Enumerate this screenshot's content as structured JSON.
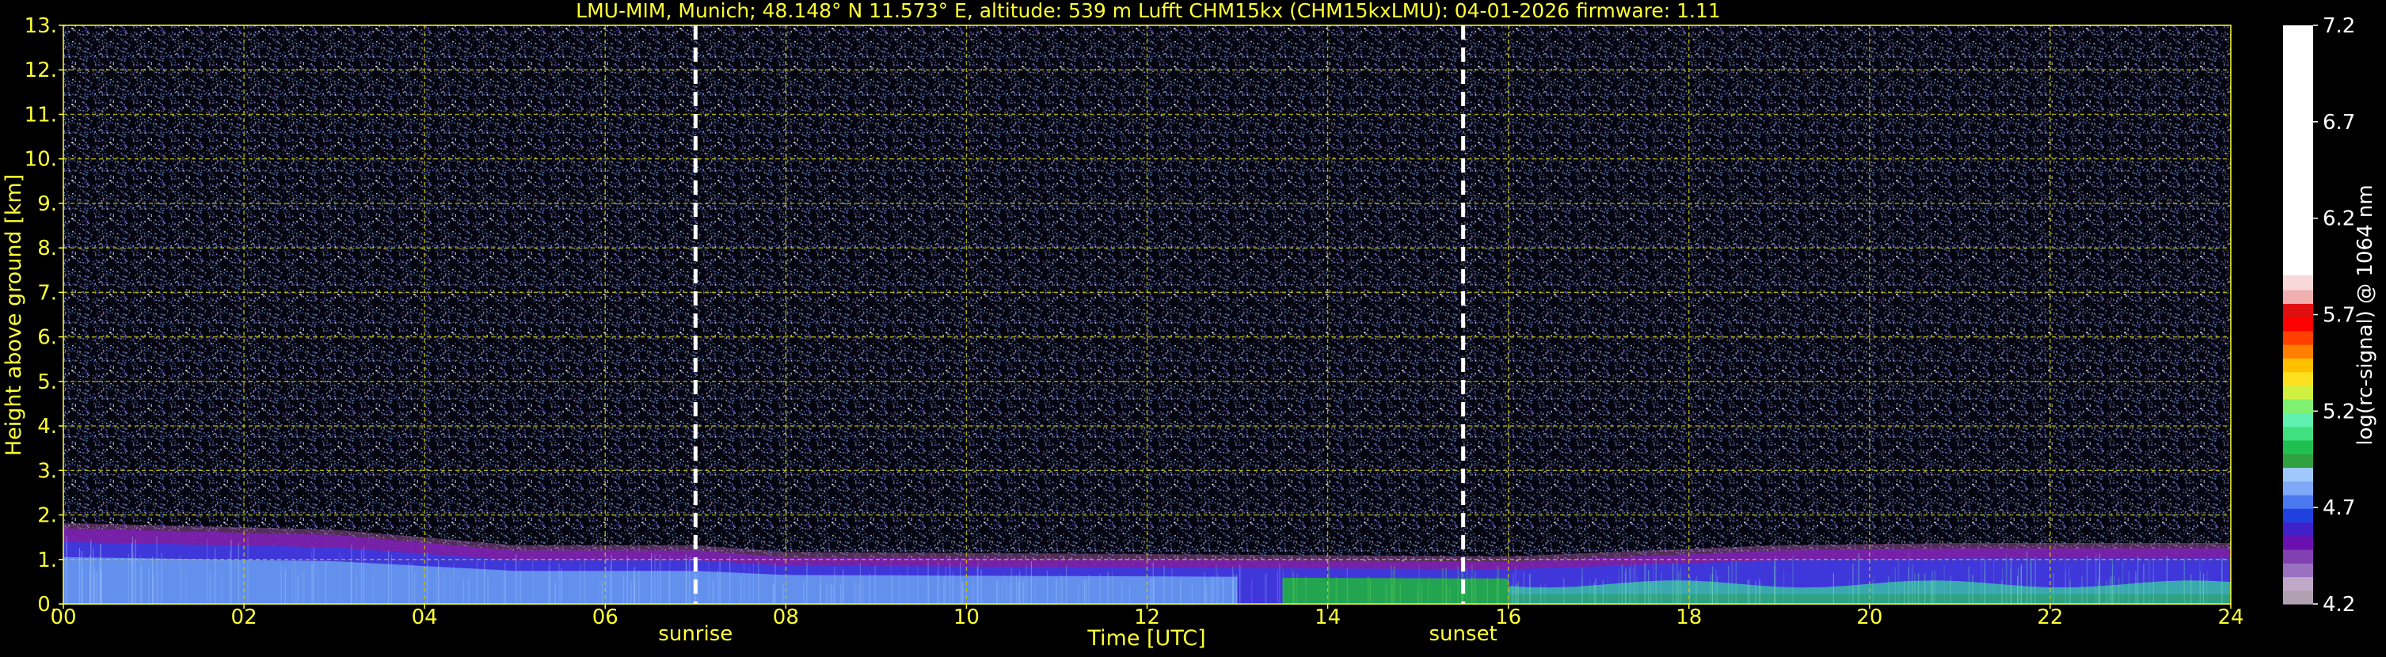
{
  "title": "LMU-MIM, Munich; 48.148° N 11.573° E, altitude: 539 m    Lufft CHM15kx (CHM15kxLMU): 04-01-2026    firmware: 1.11",
  "colors": {
    "text": "#ffff33",
    "grid": "#c8c800",
    "background": "#000000",
    "marker": "#ffffff"
  },
  "chart_data": {
    "type": "heatmap",
    "xlabel": "Time [UTC]",
    "ylabel": "Height above ground [km]",
    "xlim": [
      0,
      24
    ],
    "ylim": [
      0,
      13
    ],
    "x_ticks": [
      "00",
      "02",
      "04",
      "06",
      "08",
      "10",
      "12",
      "14",
      "16",
      "18",
      "20",
      "22",
      "24"
    ],
    "y_ticks": [
      "0.",
      "1.",
      "2.",
      "3.",
      "4.",
      "5.",
      "6.",
      "7.",
      "8.",
      "9.",
      "10.",
      "11.",
      "12.",
      "13."
    ],
    "grid": true,
    "markers": [
      {
        "label": "sunrise",
        "time": 7.0
      },
      {
        "label": "sunset",
        "time": 15.5
      }
    ],
    "colorbar": {
      "label": "log(rc-signal) @ 1064 nm",
      "ticks": [
        "4.2",
        "4.7",
        "5.2",
        "5.7",
        "6.2",
        "6.7",
        "7.2"
      ],
      "range": [
        4.2,
        7.2
      ]
    },
    "boundary_layer_top_km": [
      {
        "time": 0,
        "height": 1.7
      },
      {
        "time": 3,
        "height": 1.55
      },
      {
        "time": 5,
        "height": 1.2
      },
      {
        "time": 7,
        "height": 1.2
      },
      {
        "time": 8,
        "height": 1.05
      },
      {
        "time": 12,
        "height": 1.0
      },
      {
        "time": 16,
        "height": 0.95
      },
      {
        "time": 19,
        "height": 1.2
      },
      {
        "time": 21,
        "height": 1.25
      },
      {
        "time": 24,
        "height": 1.25
      }
    ]
  }
}
